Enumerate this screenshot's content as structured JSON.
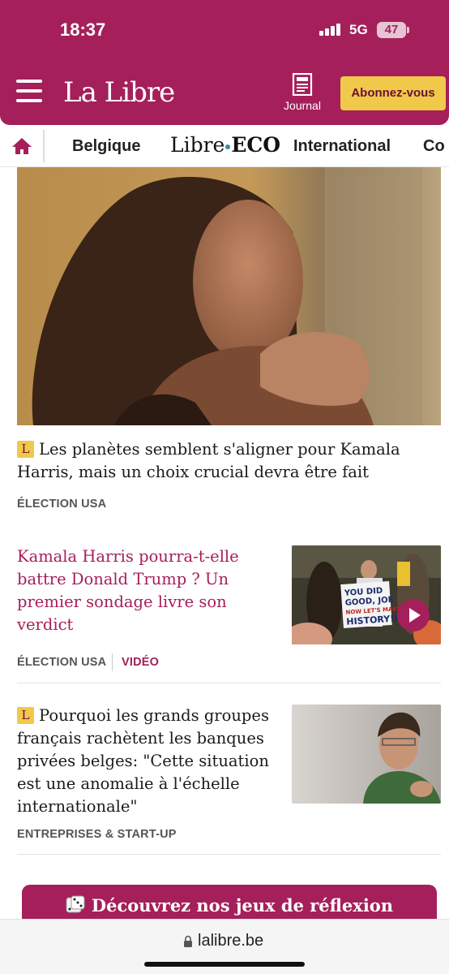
{
  "status": {
    "time": "18:37",
    "network": "5G",
    "battery": "47"
  },
  "header": {
    "logo": "La Libre",
    "journal_label": "Journal",
    "subscribe_label": "Abonnez-vous"
  },
  "nav": {
    "items": [
      "Belgique",
      "International",
      "Co"
    ],
    "eco_prefix": "Libre",
    "eco_suffix": "ECO"
  },
  "articles": [
    {
      "badge": "L",
      "title": "Les planètes semblent s'aligner pour Kamala Harris, mais un choix crucial devra être fait",
      "tag": "ÉLECTION USA"
    },
    {
      "title": "Kamala Harris pourra-t-elle battre Donald Trump ? Un premier sondage livre son verdict",
      "tag": "ÉLECTION USA",
      "tag2": "VIDÉO",
      "sign_lines": [
        "YOU DID",
        "GOOD, JOE",
        "NOW LET'S MAKE",
        "HISTORY!!!"
      ]
    },
    {
      "badge": "L",
      "title": "Pourquoi les grands groupes français rachètent les banques privées belges: \"Cette situation est une anomalie à l'échelle internationale\"",
      "tag": "ENTREPRISES & START-UP"
    }
  ],
  "games_banner": "Découvrez nos jeux de réflexion",
  "browser": {
    "url": "lalibre.be"
  },
  "colors": {
    "brand": "#a51f5a",
    "accent": "#f0c94a"
  },
  "icons": [
    "menu-icon",
    "journal-icon",
    "home-icon",
    "play-icon",
    "dice-icon",
    "lock-icon"
  ]
}
